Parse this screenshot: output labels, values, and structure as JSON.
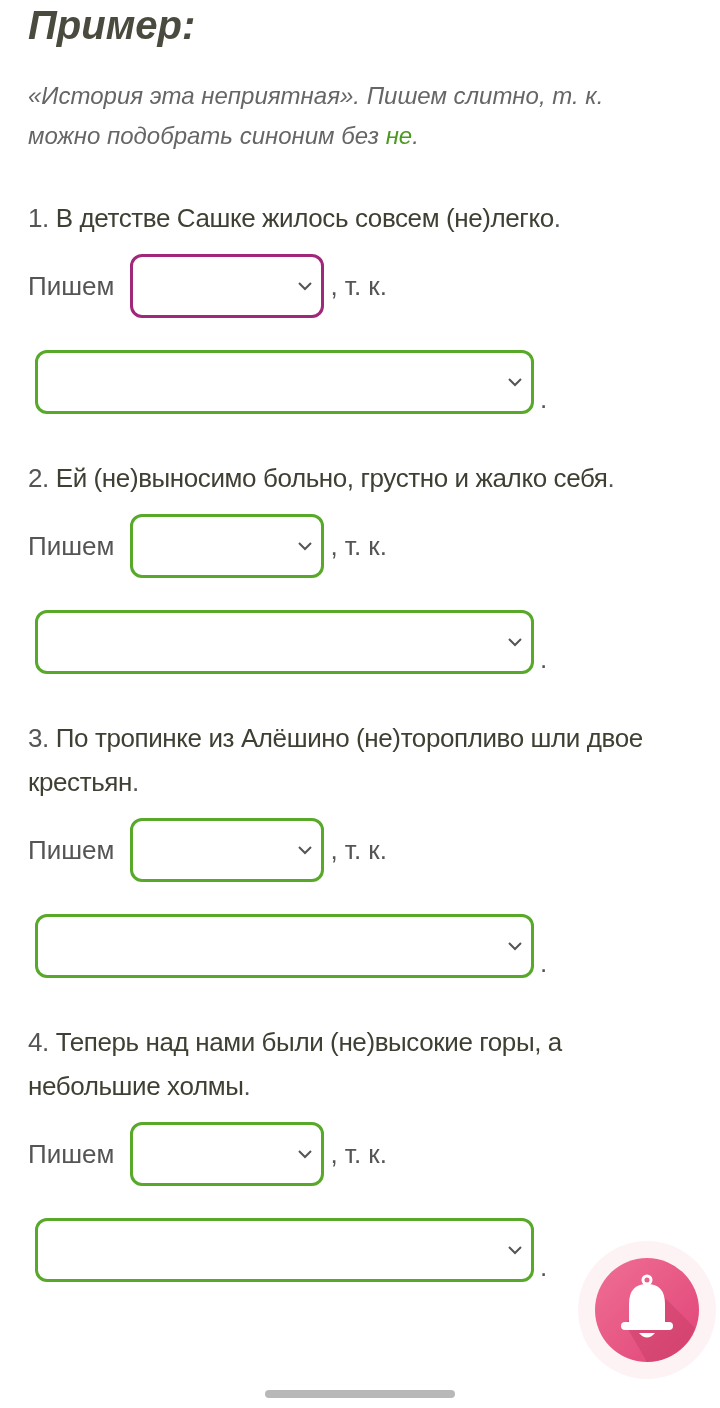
{
  "heading": "Пример:",
  "example": "«История эта неприятная».  Пишем слитно, т. к. можно подобрать синоним без **не**.",
  "tasks": [
    {
      "sentence": "1. **В детстве Сашке жилось совсем (не)легко**.",
      "label": "Пишем",
      "connector": ", т. к.",
      "end": ".",
      "choice_focused": true,
      "reason_focused": false
    },
    {
      "sentence": "2. **Ей (не)выносимо больно, грустно и жалко себя**.",
      "label": "Пишем",
      "connector": ", т. к.",
      "end": ".",
      "choice_focused": false,
      "reason_focused": false
    },
    {
      "sentence": "3. **По тропинке из Алёшино (не)торопливо шли двое крестьян**.",
      "label": "Пишем",
      "connector": ", т. к.",
      "end": ".",
      "choice_focused": false,
      "reason_focused": false
    },
    {
      "sentence": "4. **Теперь над нами были (не)высокие горы, а небольшие холмы**.",
      "label": "Пишем",
      "connector": ", т. к.",
      "end": ".",
      "choice_focused": false,
      "reason_focused": false
    }
  ]
}
